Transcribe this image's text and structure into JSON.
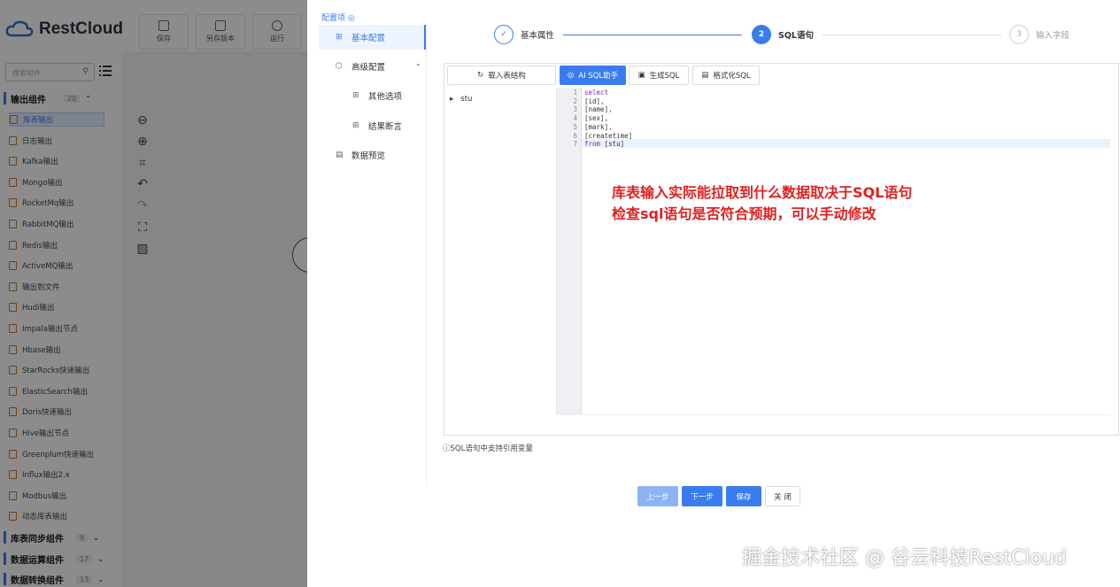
{
  "app": {
    "logo_text": "RestCloud",
    "toolbar": [
      {
        "label": "保存"
      },
      {
        "label": "另存版本"
      },
      {
        "label": "运行"
      }
    ],
    "search_placeholder": "搜索组件"
  },
  "sidebar": {
    "groups": [
      {
        "title": "输出组件",
        "count": "20",
        "expanded": true
      },
      {
        "title": "库表同步组件",
        "count": "9"
      },
      {
        "title": "数据运算组件",
        "count": "17"
      },
      {
        "title": "数据转换组件",
        "count": "13"
      }
    ],
    "items": [
      "库表输出",
      "日志输出",
      "Kafka输出",
      "Mongo输出",
      "RocketMq输出",
      "RabbitMQ输出",
      "Redis输出",
      "ActiveMQ输出",
      "输出到文件",
      "Hudi输出",
      "Impala输出节点",
      "Hbase输出",
      "StarRocks快速输出",
      "ElasticSearch输出",
      "Doris快速输出",
      "Hive输出节点",
      "Greenplum快速输出",
      "Influx输出2.x",
      "Modbus输出",
      "动态库表输出"
    ]
  },
  "drawer": {
    "config_title": "配置项",
    "nav": [
      {
        "label": "基本配置",
        "active": true
      },
      {
        "label": "高级配置"
      },
      {
        "label": "其他选项"
      },
      {
        "label": "结果断言"
      },
      {
        "label": "数据预览"
      }
    ],
    "steps": [
      {
        "num": "✓",
        "label": "基本属性",
        "state": "done"
      },
      {
        "num": "2",
        "label": "SQL语句",
        "state": "current"
      },
      {
        "num": "3",
        "label": "输入字段",
        "state": "todo"
      }
    ],
    "editor": {
      "load_button": "载入表结构",
      "ai_button": "AI SQL助手",
      "gen_button": "生成SQL",
      "format_button": "格式化SQL",
      "tree_item": "stu",
      "lines": [
        "select",
        "[id],",
        "[name],",
        "[sex],",
        "[mark],",
        "[createtime]",
        "from [stu]"
      ]
    },
    "annotation": [
      "库表输入实际能拉取到什么数据取决于SQL语句",
      "检查sql语句是否符合预期，可以手动修改"
    ],
    "hint": "SQL语句中支持引用变量",
    "footer": {
      "prev": "上一步",
      "next": "下一步",
      "save": "保存",
      "close": "关 闭"
    }
  },
  "watermark": "掘金技术社区 @ 谷云科技RestCloud",
  "colors": {
    "accent": "#3a7cf0",
    "annotation": "#e02020"
  }
}
